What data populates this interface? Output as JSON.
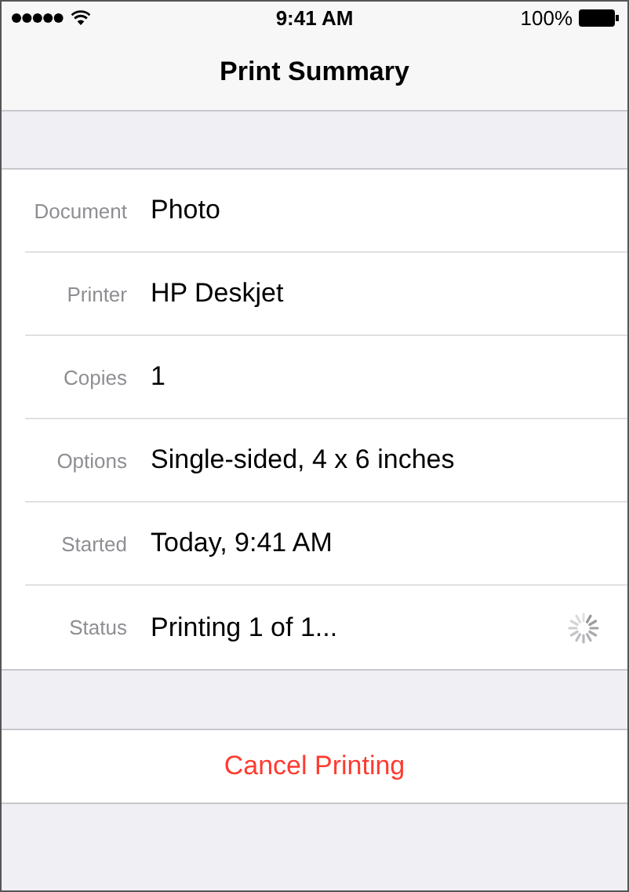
{
  "status_bar": {
    "time": "9:41 AM",
    "battery": "100%"
  },
  "navigation": {
    "title": "Print Summary"
  },
  "details": [
    {
      "label": "Document",
      "value": "Photo",
      "kind": "text"
    },
    {
      "label": "Printer",
      "value": "HP Deskjet",
      "kind": "text"
    },
    {
      "label": "Copies",
      "value": "1",
      "kind": "text"
    },
    {
      "label": "Options",
      "value": "Single-sided, 4 x 6 inches",
      "kind": "text"
    },
    {
      "label": "Started",
      "value": "Today, 9:41 AM",
      "kind": "text"
    },
    {
      "label": "Status",
      "value": "Printing 1 of 1...",
      "kind": "progress"
    }
  ],
  "action": {
    "label": "Cancel Printing"
  }
}
